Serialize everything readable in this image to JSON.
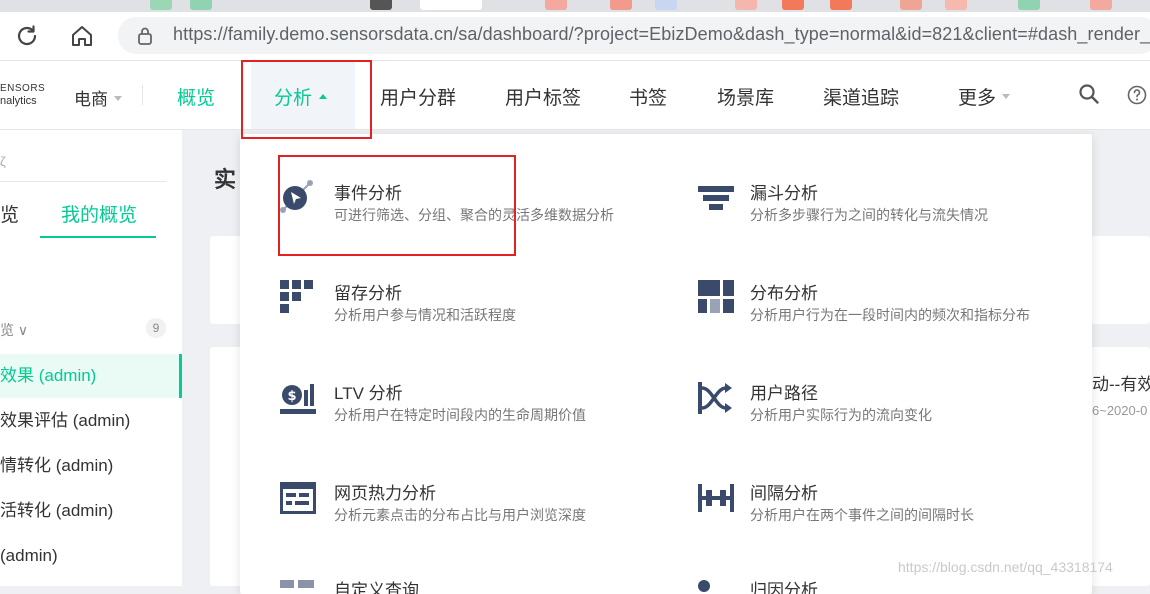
{
  "browser": {
    "url": "https://family.demo.sensorsdata.cn/sa/dashboard/?project=EbizDemo&dash_type=normal&id=821&client=#dash_render_type",
    "tab_colors": [
      "#f3a9a0",
      "#9bd7b4",
      "#f29a8c",
      "#c9d6f2",
      "#f4b6ad",
      "#f27a5b",
      "#f0a494",
      "#8fd3b0",
      "#f5b9ad"
    ]
  },
  "app": {
    "logo_line1": "ENSORS",
    "logo_line2": "nalytics",
    "project": "电商",
    "nav": [
      {
        "label": "概览"
      },
      {
        "label": "分析"
      },
      {
        "label": "用户分群"
      },
      {
        "label": "用户标签"
      },
      {
        "label": "书签"
      },
      {
        "label": "场景库"
      },
      {
        "label": "渠道追踪"
      },
      {
        "label": "更多"
      }
    ],
    "accent_color": "#04cb94",
    "icon_color": "#3a4a6b"
  },
  "sidebar": {
    "search_fragment": "ζ",
    "tab_fragment": "览",
    "active_tab": "我的概览",
    "group_label": "览 ∨",
    "group_count": "9",
    "items": [
      {
        "label": "效果 (admin)"
      },
      {
        "label": "效果评估 (admin)"
      },
      {
        "label": "情转化 (admin)"
      },
      {
        "label": "活转化 (admin)"
      },
      {
        "label": "(admin)"
      }
    ]
  },
  "main": {
    "title_fragment": "实",
    "card2_title_fragment": "动--有效",
    "card2_sub_fragment": "6~2020-0"
  },
  "dropdown": {
    "items": [
      {
        "title": "事件分析",
        "desc": "可进行筛选、分组、聚合的灵活多维数据分析",
        "icon": "event-analysis-icon"
      },
      {
        "title": "漏斗分析",
        "desc": "分析多步骤行为之间的转化与流失情况",
        "icon": "funnel-icon"
      },
      {
        "title": "留存分析",
        "desc": "分析用户参与情况和活跃程度",
        "icon": "retention-icon"
      },
      {
        "title": "分布分析",
        "desc": "分析用户行为在一段时间内的频次和指标分布",
        "icon": "distribution-icon"
      },
      {
        "title": "LTV 分析",
        "desc": "分析用户在特定时间段内的生命周期价值",
        "icon": "ltv-icon"
      },
      {
        "title": "用户路径",
        "desc": "分析用户实际行为的流向变化",
        "icon": "user-path-icon"
      },
      {
        "title": "网页热力分析",
        "desc": "分析元素点击的分布占比与用户浏览深度",
        "icon": "heatmap-icon"
      },
      {
        "title": "间隔分析",
        "desc": "分析用户在两个事件之间的间隔时长",
        "icon": "interval-icon"
      },
      {
        "title": "自定义查询",
        "desc": "",
        "icon": "custom-query-icon"
      },
      {
        "title": "归因分析",
        "desc": "",
        "icon": "attribution-icon"
      }
    ]
  },
  "watermark": "https://blog.csdn.net/qq_43318174"
}
